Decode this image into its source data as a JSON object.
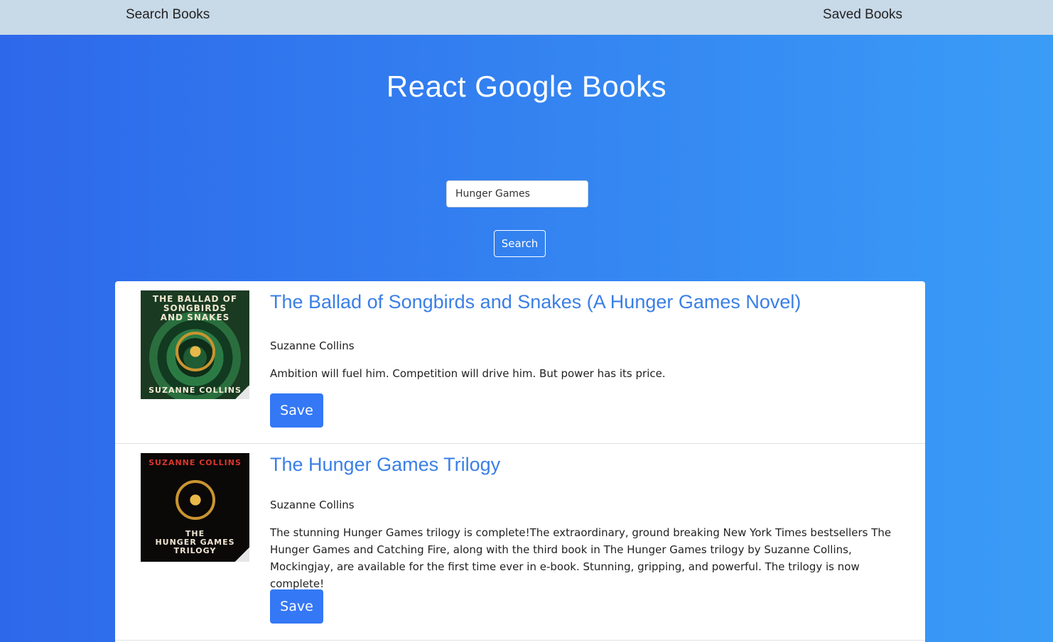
{
  "nav": {
    "search_label": "Search Books",
    "saved_label": "Saved Books"
  },
  "header": {
    "title": "React Google Books"
  },
  "search": {
    "value": "Hunger Games",
    "button_label": "Search"
  },
  "books": [
    {
      "title": "The Ballad of Songbirds and Snakes (A Hunger Games Novel)",
      "author": "Suzanne Collins",
      "description": "Ambition will fuel him. Competition will drive him. But power has its price.",
      "save_label": "Save",
      "cover": {
        "title_lines": [
          "THE BALLAD OF",
          "SONGBIRDS",
          "AND SNAKES"
        ],
        "author": "SUZANNE COLLINS"
      }
    },
    {
      "title": "The Hunger Games Trilogy",
      "author": "Suzanne Collins",
      "description": "The stunning Hunger Games trilogy is complete!The extraordinary, ground breaking New York Times bestsellers The Hunger Games and Catching Fire, along with the third book in The Hunger Games trilogy by Suzanne Collins, Mockingjay, are available for the first time ever in e-book. Stunning, gripping, and powerful. The trilogy is now complete!",
      "save_label": "Save",
      "cover": {
        "author": "SUZANNE COLLINS",
        "title_lines": [
          "THE",
          "HUNGER GAMES",
          "TRILOGY"
        ]
      }
    }
  ],
  "colors": {
    "accent": "#3478f6",
    "title_link": "#3a7fe6",
    "navbar": "#c8d9e8"
  }
}
